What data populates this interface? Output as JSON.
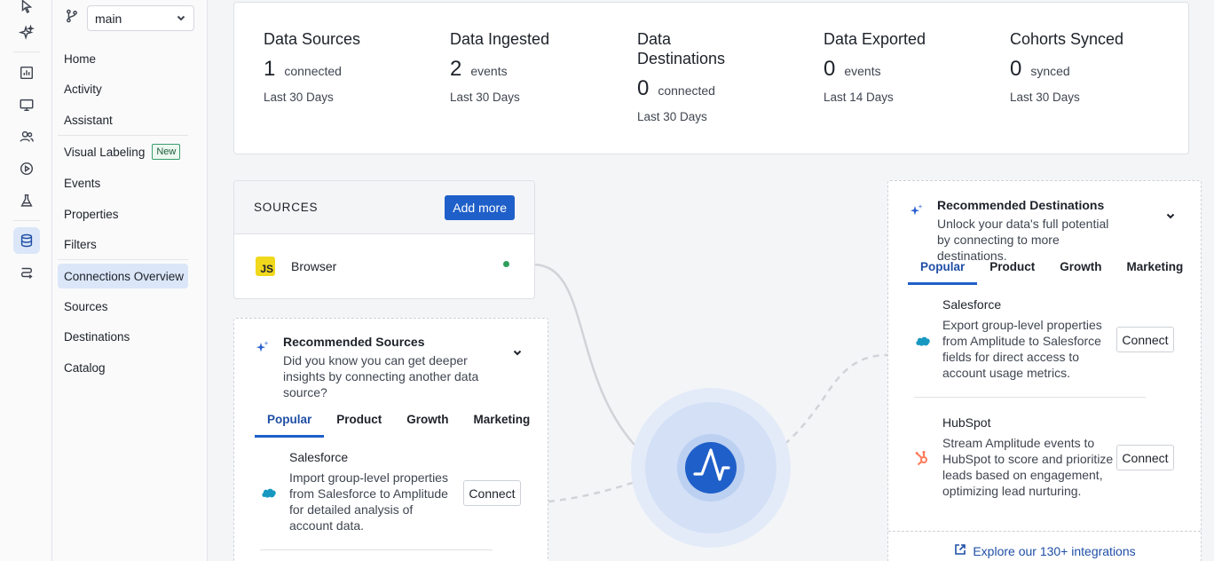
{
  "nav": {
    "branch": "main",
    "items": [
      {
        "label": "Home"
      },
      {
        "label": "Activity"
      },
      {
        "label": "Assistant"
      },
      {
        "label": "Visual Labeling",
        "badge": "New"
      },
      {
        "label": "Events"
      },
      {
        "label": "Properties"
      },
      {
        "label": "Filters"
      },
      {
        "label": "Connections Overview",
        "active": true
      },
      {
        "label": "Sources"
      },
      {
        "label": "Destinations"
      },
      {
        "label": "Catalog"
      }
    ]
  },
  "stats": [
    {
      "title": "Data Sources",
      "value": "1",
      "unit": "connected",
      "period": "Last 30 Days"
    },
    {
      "title": "Data Ingested",
      "value": "2",
      "unit": "events",
      "period": "Last 30 Days"
    },
    {
      "title": "Data Destinations",
      "value": "0",
      "unit": "connected",
      "period": "Last 30 Days"
    },
    {
      "title": "Data Exported",
      "value": "0",
      "unit": "events",
      "period": "Last 14 Days"
    },
    {
      "title": "Cohorts Synced",
      "value": "0",
      "unit": "synced",
      "period": "Last 30 Days"
    }
  ],
  "sources": {
    "title": "SOURCES",
    "add_more": "Add more",
    "items": [
      {
        "icon": "JS",
        "name": "Browser",
        "status_color": "#2e9e5b"
      }
    ]
  },
  "rec_sources": {
    "title": "Recommended Sources",
    "description": "Did you know you can get deeper insights by connecting another data source?",
    "tabs": [
      "Popular",
      "Product",
      "Growth",
      "Marketing"
    ],
    "active_tab": "Popular",
    "items": [
      {
        "name": "Salesforce",
        "description": "Import group-level properties from Salesforce to Amplitude for detailed analysis of account data.",
        "action": "Connect"
      }
    ]
  },
  "rec_dest": {
    "title": "Recommended Destinations",
    "description": "Unlock your data's full potential by connecting to more destinations.",
    "tabs": [
      "Popular",
      "Product",
      "Growth",
      "Marketing"
    ],
    "active_tab": "Popular",
    "items": [
      {
        "name": "Salesforce",
        "description": "Export group-level properties from Amplitude to Salesforce fields for direct access to account usage metrics.",
        "action": "Connect"
      },
      {
        "name": "HubSpot",
        "description": "Stream Amplitude events to HubSpot to score and prioritize leads based on engagement, optimizing lead nurturing.",
        "action": "Connect"
      }
    ],
    "explore": "Explore our 130+ integrations"
  },
  "colors": {
    "accent": "#1f5fc9",
    "salesforce": "#1798c1",
    "hubspot": "#ff7a59",
    "hub": "#1f5fc9"
  }
}
